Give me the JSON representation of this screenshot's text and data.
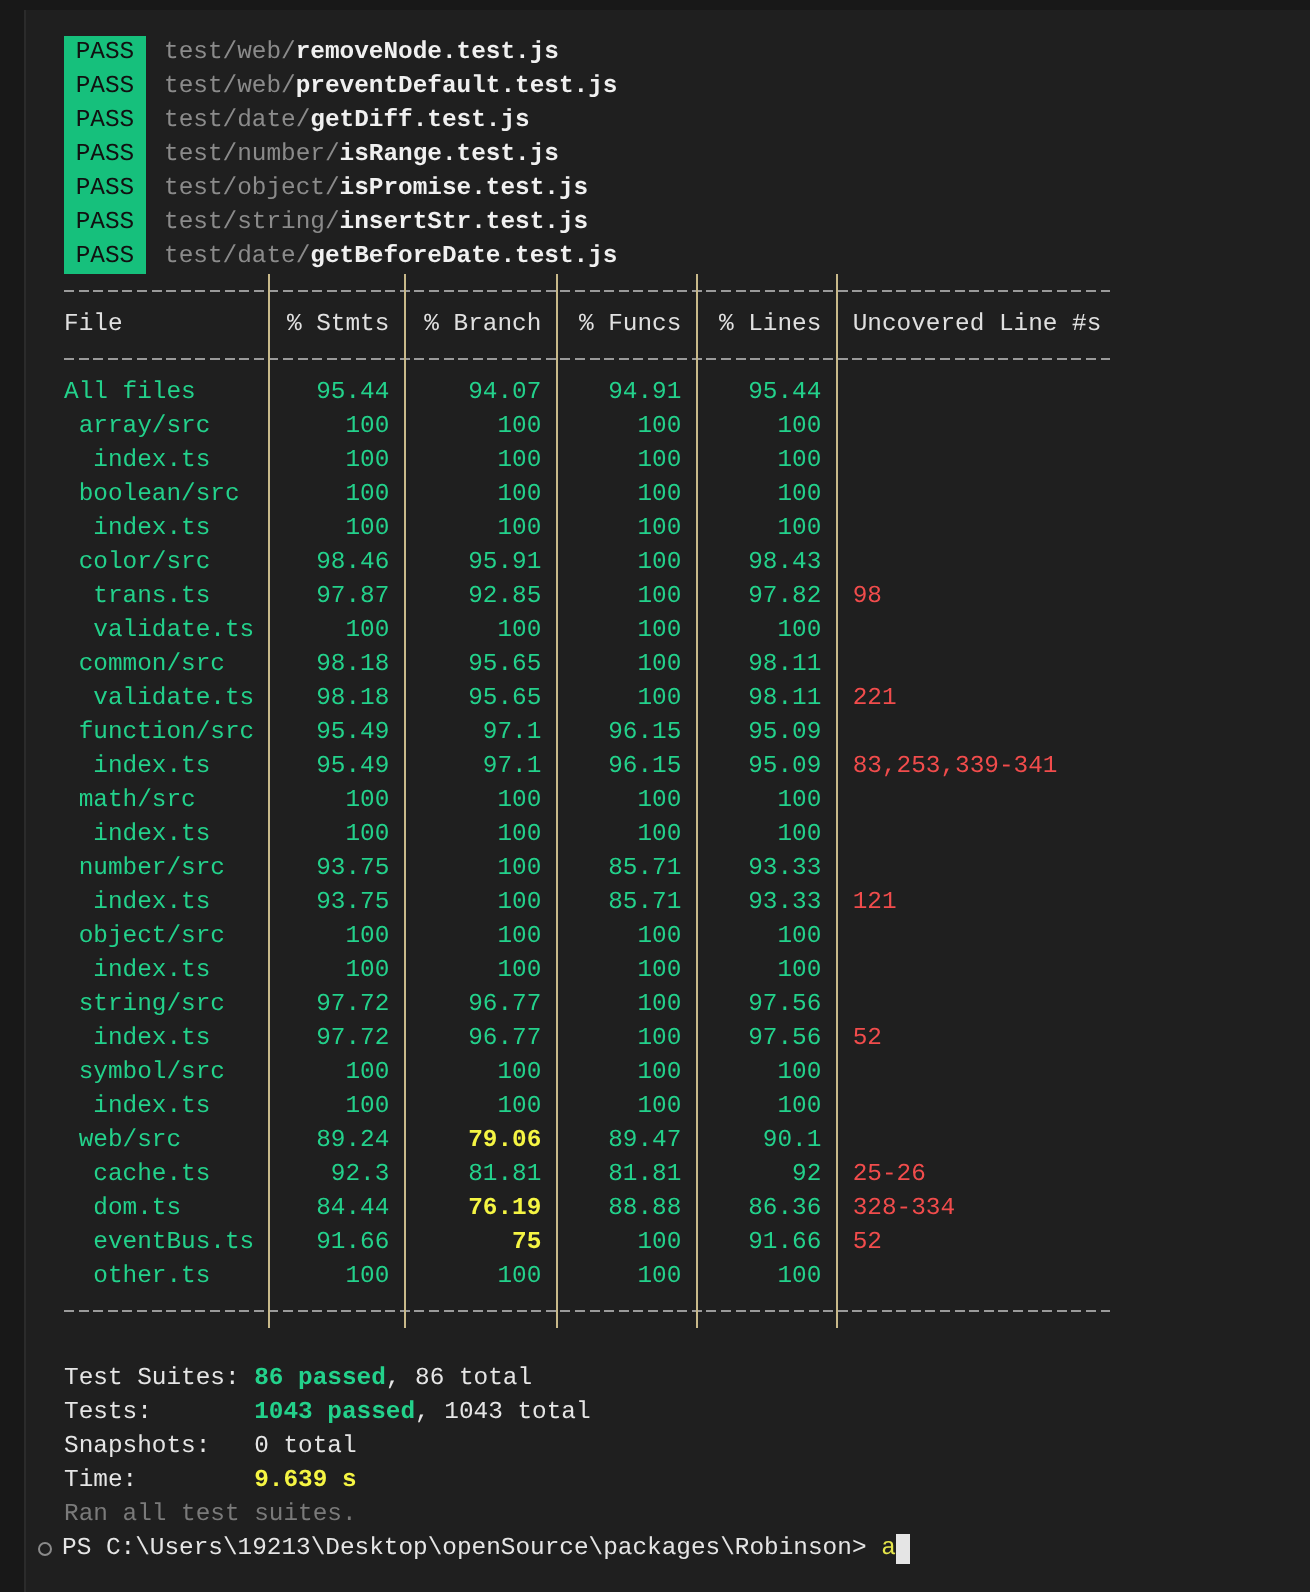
{
  "test_results": [
    {
      "status": "PASS",
      "dir": "test/web/",
      "file": "removeNode.test.js"
    },
    {
      "status": "PASS",
      "dir": "test/web/",
      "file": "preventDefault.test.js"
    },
    {
      "status": "PASS",
      "dir": "test/date/",
      "file": "getDiff.test.js"
    },
    {
      "status": "PASS",
      "dir": "test/number/",
      "file": "isRange.test.js"
    },
    {
      "status": "PASS",
      "dir": "test/object/",
      "file": "isPromise.test.js"
    },
    {
      "status": "PASS",
      "dir": "test/string/",
      "file": "insertStr.test.js"
    },
    {
      "status": "PASS",
      "dir": "test/date/",
      "file": "getBeforeDate.test.js"
    }
  ],
  "coverage_table": {
    "columns": [
      "File",
      "% Stmts",
      "% Branch",
      "% Funcs",
      "% Lines",
      "Uncovered Line #s"
    ],
    "rows": [
      {
        "file": "All files",
        "metrics": [
          "95.44",
          "94.07",
          "94.91",
          "95.44"
        ],
        "low": [
          false,
          false,
          false,
          false
        ],
        "children": [
          {
            "file": "array/src",
            "metrics": [
              "100",
              "100",
              "100",
              "100"
            ],
            "low": [
              false,
              false,
              false,
              false
            ],
            "children": [
              {
                "file": "index.ts",
                "metrics": [
                  "100",
                  "100",
                  "100",
                  "100"
                ],
                "low": [
                  false,
                  false,
                  false,
                  false
                ]
              }
            ]
          },
          {
            "file": "boolean/src",
            "metrics": [
              "100",
              "100",
              "100",
              "100"
            ],
            "low": [
              false,
              false,
              false,
              false
            ],
            "children": [
              {
                "file": "index.ts",
                "metrics": [
                  "100",
                  "100",
                  "100",
                  "100"
                ],
                "low": [
                  false,
                  false,
                  false,
                  false
                ]
              }
            ]
          },
          {
            "file": "color/src",
            "metrics": [
              "98.46",
              "95.91",
              "100",
              "98.43"
            ],
            "low": [
              false,
              false,
              false,
              false
            ],
            "children": [
              {
                "file": "trans.ts",
                "metrics": [
                  "97.87",
                  "92.85",
                  "100",
                  "97.82"
                ],
                "low": [
                  false,
                  false,
                  false,
                  false
                ],
                "uncovered": "98"
              },
              {
                "file": "validate.ts",
                "metrics": [
                  "100",
                  "100",
                  "100",
                  "100"
                ],
                "low": [
                  false,
                  false,
                  false,
                  false
                ]
              }
            ]
          },
          {
            "file": "common/src",
            "metrics": [
              "98.18",
              "95.65",
              "100",
              "98.11"
            ],
            "low": [
              false,
              false,
              false,
              false
            ],
            "children": [
              {
                "file": "validate.ts",
                "metrics": [
                  "98.18",
                  "95.65",
                  "100",
                  "98.11"
                ],
                "low": [
                  false,
                  false,
                  false,
                  false
                ],
                "uncovered": "221"
              }
            ]
          },
          {
            "file": "function/src",
            "metrics": [
              "95.49",
              "97.1",
              "96.15",
              "95.09"
            ],
            "low": [
              false,
              false,
              false,
              false
            ],
            "children": [
              {
                "file": "index.ts",
                "metrics": [
                  "95.49",
                  "97.1",
                  "96.15",
                  "95.09"
                ],
                "low": [
                  false,
                  false,
                  false,
                  false
                ],
                "uncovered": "83,253,339-341"
              }
            ]
          },
          {
            "file": "math/src",
            "metrics": [
              "100",
              "100",
              "100",
              "100"
            ],
            "low": [
              false,
              false,
              false,
              false
            ],
            "children": [
              {
                "file": "index.ts",
                "metrics": [
                  "100",
                  "100",
                  "100",
                  "100"
                ],
                "low": [
                  false,
                  false,
                  false,
                  false
                ]
              }
            ]
          },
          {
            "file": "number/src",
            "metrics": [
              "93.75",
              "100",
              "85.71",
              "93.33"
            ],
            "low": [
              false,
              false,
              false,
              false
            ],
            "children": [
              {
                "file": "index.ts",
                "metrics": [
                  "93.75",
                  "100",
                  "85.71",
                  "93.33"
                ],
                "low": [
                  false,
                  false,
                  false,
                  false
                ],
                "uncovered": "121"
              }
            ]
          },
          {
            "file": "object/src",
            "metrics": [
              "100",
              "100",
              "100",
              "100"
            ],
            "low": [
              false,
              false,
              false,
              false
            ],
            "children": [
              {
                "file": "index.ts",
                "metrics": [
                  "100",
                  "100",
                  "100",
                  "100"
                ],
                "low": [
                  false,
                  false,
                  false,
                  false
                ]
              }
            ]
          },
          {
            "file": "string/src",
            "metrics": [
              "97.72",
              "96.77",
              "100",
              "97.56"
            ],
            "low": [
              false,
              false,
              false,
              false
            ],
            "children": [
              {
                "file": "index.ts",
                "metrics": [
                  "97.72",
                  "96.77",
                  "100",
                  "97.56"
                ],
                "low": [
                  false,
                  false,
                  false,
                  false
                ],
                "uncovered": "52"
              }
            ]
          },
          {
            "file": "symbol/src",
            "metrics": [
              "100",
              "100",
              "100",
              "100"
            ],
            "low": [
              false,
              false,
              false,
              false
            ],
            "children": [
              {
                "file": "index.ts",
                "metrics": [
                  "100",
                  "100",
                  "100",
                  "100"
                ],
                "low": [
                  false,
                  false,
                  false,
                  false
                ]
              }
            ]
          },
          {
            "file": "web/src",
            "metrics": [
              "89.24",
              "79.06",
              "89.47",
              "90.1"
            ],
            "low": [
              false,
              true,
              false,
              false
            ],
            "children": [
              {
                "file": "cache.ts",
                "metrics": [
                  "92.3",
                  "81.81",
                  "81.81",
                  "92"
                ],
                "low": [
                  false,
                  false,
                  false,
                  false
                ],
                "uncovered": "25-26"
              },
              {
                "file": "dom.ts",
                "metrics": [
                  "84.44",
                  "76.19",
                  "88.88",
                  "86.36"
                ],
                "low": [
                  false,
                  true,
                  false,
                  false
                ],
                "uncovered": "328-334"
              },
              {
                "file": "eventBus.ts",
                "metrics": [
                  "91.66",
                  "75",
                  "100",
                  "91.66"
                ],
                "low": [
                  false,
                  true,
                  false,
                  false
                ],
                "uncovered": "52"
              },
              {
                "file": "other.ts",
                "metrics": [
                  "100",
                  "100",
                  "100",
                  "100"
                ],
                "low": [
                  false,
                  false,
                  false,
                  false
                ]
              }
            ]
          }
        ]
      }
    ]
  },
  "summary": [
    {
      "label": "Test Suites:",
      "parts": [
        {
          "text": "86 passed",
          "color": "#23d18b",
          "bold": true
        },
        {
          "text": ", 86 total",
          "color": "#e5e5e5",
          "bold": false
        }
      ]
    },
    {
      "label": "Tests:",
      "parts": [
        {
          "text": "1043 passed",
          "color": "#23d18b",
          "bold": true
        },
        {
          "text": ", 1043 total",
          "color": "#e5e5e5",
          "bold": false
        }
      ]
    },
    {
      "label": "Snapshots:",
      "parts": [
        {
          "text": "0 total",
          "color": "#e5e5e5",
          "bold": false
        }
      ]
    },
    {
      "label": "Time:",
      "parts": [
        {
          "text": "9.639 s",
          "color": "#f5f543",
          "bold": true
        }
      ]
    }
  ],
  "footer_note": "Ran all test suites.",
  "prompt": {
    "text": "PS C:\\Users\\19213\\Desktop\\openSource\\packages\\Robinson>",
    "input": "a"
  }
}
